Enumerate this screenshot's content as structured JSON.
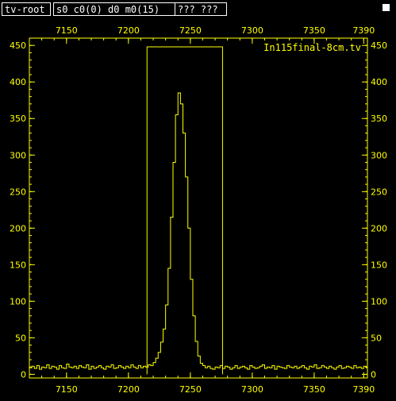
{
  "window": {
    "name_box": "tv-root",
    "status_box": "s0 c0(0) d0 m0(15)",
    "coords_box": "??? ???"
  },
  "colors": {
    "background": "#000000",
    "trace": "#ffff00",
    "frame": "#ffff00",
    "text": "#ffffff"
  },
  "chart_data": {
    "type": "line",
    "title": "In115final-8cm.tv",
    "xlim": [
      7120,
      7393
    ],
    "ylim": [
      -5,
      460
    ],
    "x_ticks": [
      7150,
      7200,
      7250,
      7300,
      7350,
      7390
    ],
    "y_ticks": [
      0,
      50,
      100,
      150,
      200,
      250,
      300,
      350,
      400,
      450
    ],
    "x_tick_labels": [
      "7150",
      "7200",
      "7250",
      "7300",
      "7350",
      "7390"
    ],
    "y_tick_labels": [
      "0",
      "50",
      "100",
      "150",
      "200",
      "250",
      "300",
      "350",
      "400",
      "450"
    ],
    "gate_region": {
      "x_start": 7215,
      "x_end": 7276,
      "y_top": 448
    },
    "series": [
      {
        "x": [
          7120,
          7122,
          7124,
          7126,
          7128,
          7130,
          7132,
          7134,
          7136,
          7138,
          7140,
          7142,
          7144,
          7146,
          7148,
          7150,
          7152,
          7154,
          7156,
          7158,
          7160,
          7162,
          7164,
          7166,
          7168,
          7170,
          7172,
          7174,
          7176,
          7178,
          7180,
          7182,
          7184,
          7186,
          7188,
          7190,
          7192,
          7194,
          7196,
          7198,
          7200,
          7202,
          7204,
          7206,
          7208,
          7210,
          7212,
          7214,
          7216,
          7218,
          7220,
          7222,
          7224,
          7226,
          7228,
          7230,
          7232,
          7234,
          7236,
          7238,
          7240,
          7242,
          7244,
          7246,
          7248,
          7250,
          7252,
          7254,
          7256,
          7258,
          7260,
          7262,
          7264,
          7266,
          7268,
          7270,
          7272,
          7274,
          7276,
          7278,
          7280,
          7282,
          7284,
          7286,
          7288,
          7290,
          7292,
          7294,
          7296,
          7298,
          7300,
          7302,
          7304,
          7306,
          7308,
          7310,
          7312,
          7314,
          7316,
          7318,
          7320,
          7322,
          7324,
          7326,
          7328,
          7330,
          7332,
          7334,
          7336,
          7338,
          7340,
          7342,
          7344,
          7346,
          7348,
          7350,
          7352,
          7354,
          7356,
          7358,
          7360,
          7362,
          7364,
          7366,
          7368,
          7370,
          7372,
          7374,
          7376,
          7378,
          7380,
          7382,
          7384,
          7386,
          7388,
          7390,
          7392
        ],
        "y": [
          9,
          11,
          8,
          12,
          7,
          10,
          9,
          13,
          8,
          11,
          10,
          7,
          12,
          9,
          8,
          14,
          10,
          9,
          11,
          8,
          12,
          10,
          9,
          13,
          7,
          11,
          8,
          10,
          12,
          9,
          7,
          11,
          10,
          13,
          8,
          9,
          12,
          10,
          8,
          11,
          9,
          13,
          10,
          8,
          12,
          9,
          11,
          10,
          13,
          12,
          16,
          22,
          30,
          44,
          62,
          95,
          145,
          215,
          290,
          355,
          385,
          370,
          330,
          270,
          200,
          130,
          80,
          45,
          25,
          15,
          12,
          9,
          11,
          8,
          7,
          10,
          9,
          12,
          8,
          11,
          10,
          7,
          9,
          12,
          8,
          10,
          11,
          9,
          7,
          12,
          10,
          8,
          9,
          11,
          13,
          8,
          10,
          9,
          12,
          7,
          11,
          10,
          9,
          8,
          12,
          10,
          9,
          11,
          8,
          10,
          12,
          9,
          7,
          11,
          10,
          13,
          8,
          9,
          12,
          10,
          8,
          11,
          9,
          7,
          10,
          12,
          8,
          9,
          11,
          10,
          8,
          12,
          9,
          10,
          8,
          11,
          9
        ]
      }
    ]
  }
}
